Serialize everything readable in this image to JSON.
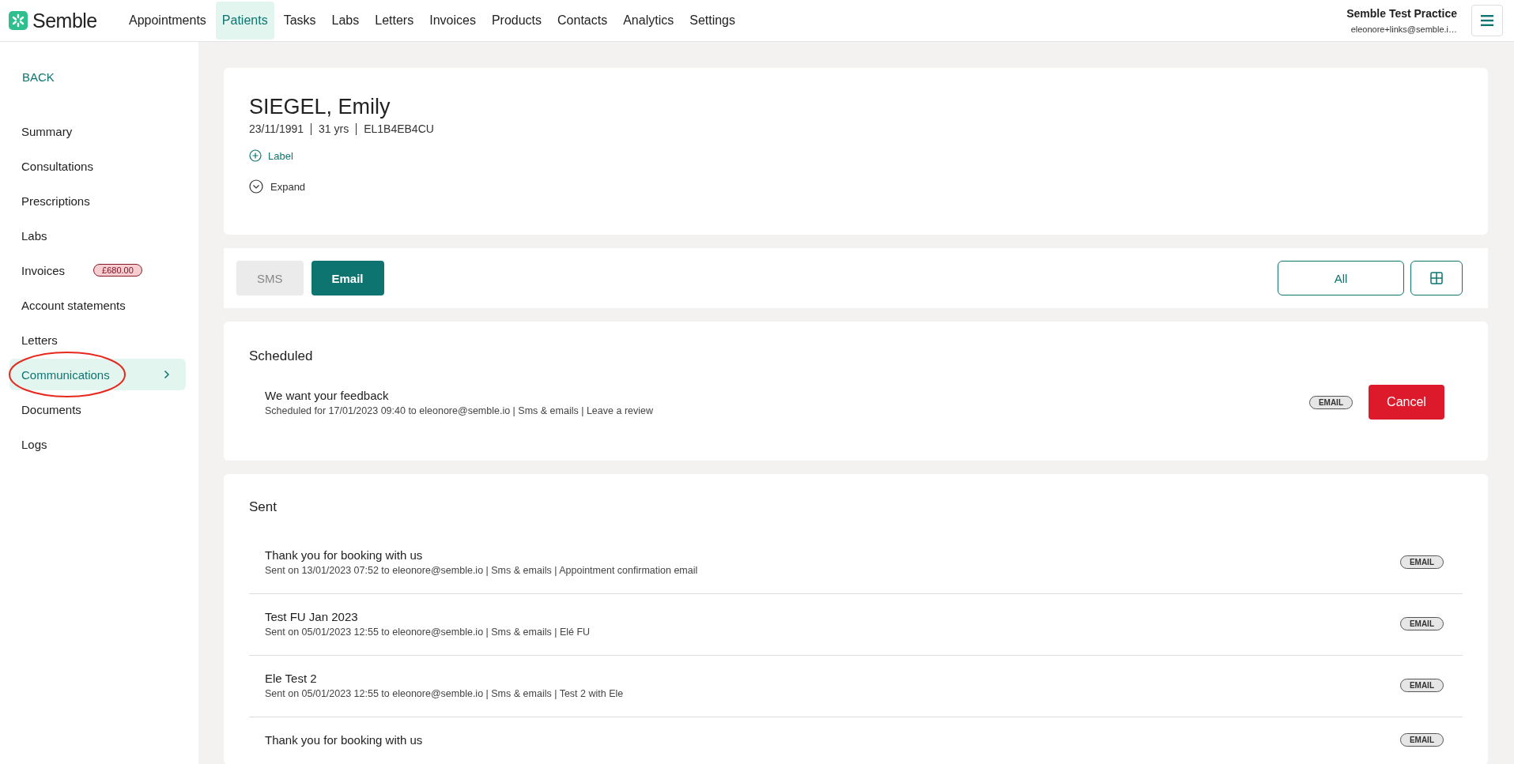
{
  "brand": {
    "name": "Semble"
  },
  "nav": [
    {
      "label": "Appointments",
      "selected": false
    },
    {
      "label": "Patients",
      "selected": true
    },
    {
      "label": "Tasks",
      "selected": false
    },
    {
      "label": "Labs",
      "selected": false
    },
    {
      "label": "Letters",
      "selected": false
    },
    {
      "label": "Invoices",
      "selected": false
    },
    {
      "label": "Products",
      "selected": false
    },
    {
      "label": "Contacts",
      "selected": false
    },
    {
      "label": "Analytics",
      "selected": false
    },
    {
      "label": "Settings",
      "selected": false
    }
  ],
  "account": {
    "practice": "Semble Test Practice",
    "email": "eleonore+links@semble.i…"
  },
  "sidebar": {
    "back": "BACK",
    "items": [
      {
        "label": "Summary",
        "selected": false
      },
      {
        "label": "Consultations",
        "selected": false
      },
      {
        "label": "Prescriptions",
        "selected": false
      },
      {
        "label": "Labs",
        "selected": false
      },
      {
        "label": "Invoices",
        "selected": false,
        "badge": "£680.00"
      },
      {
        "label": "Account statements",
        "selected": false
      },
      {
        "label": "Letters",
        "selected": false
      },
      {
        "label": "Communications",
        "selected": true,
        "circled": true
      },
      {
        "label": "Documents",
        "selected": false
      },
      {
        "label": "Logs",
        "selected": false
      }
    ]
  },
  "patient": {
    "name": "SIEGEL, Emily",
    "dob": "23/11/1991",
    "age": "31 yrs",
    "id": "EL1B4EB4CU",
    "label_action": "Label",
    "expand_action": "Expand"
  },
  "channel_tabs": [
    {
      "label": "SMS",
      "selected": false
    },
    {
      "label": "Email",
      "selected": true
    }
  ],
  "filter": {
    "label": "All"
  },
  "scheduled": {
    "title": "Scheduled",
    "items": [
      {
        "title": "We want your feedback",
        "detail": "Scheduled for 17/01/2023 09:40 to eleonore@semble.io | Sms & emails | Leave a review",
        "channel": "EMAIL",
        "action": "Cancel"
      }
    ]
  },
  "sent": {
    "title": "Sent",
    "items": [
      {
        "title": "Thank you for booking with us",
        "detail": "Sent on 13/01/2023 07:52 to eleonore@semble.io | Sms & emails | Appointment confirmation email",
        "channel": "EMAIL"
      },
      {
        "title": "Test FU Jan 2023",
        "detail": "Sent on 05/01/2023 12:55 to eleonore@semble.io | Sms & emails | Elé FU",
        "channel": "EMAIL"
      },
      {
        "title": "Ele Test 2",
        "detail": "Sent on 05/01/2023 12:55 to eleonore@semble.io | Sms & emails | Test 2 with Ele",
        "channel": "EMAIL"
      },
      {
        "title": "Thank you for booking with us",
        "channel": "EMAIL"
      }
    ]
  }
}
